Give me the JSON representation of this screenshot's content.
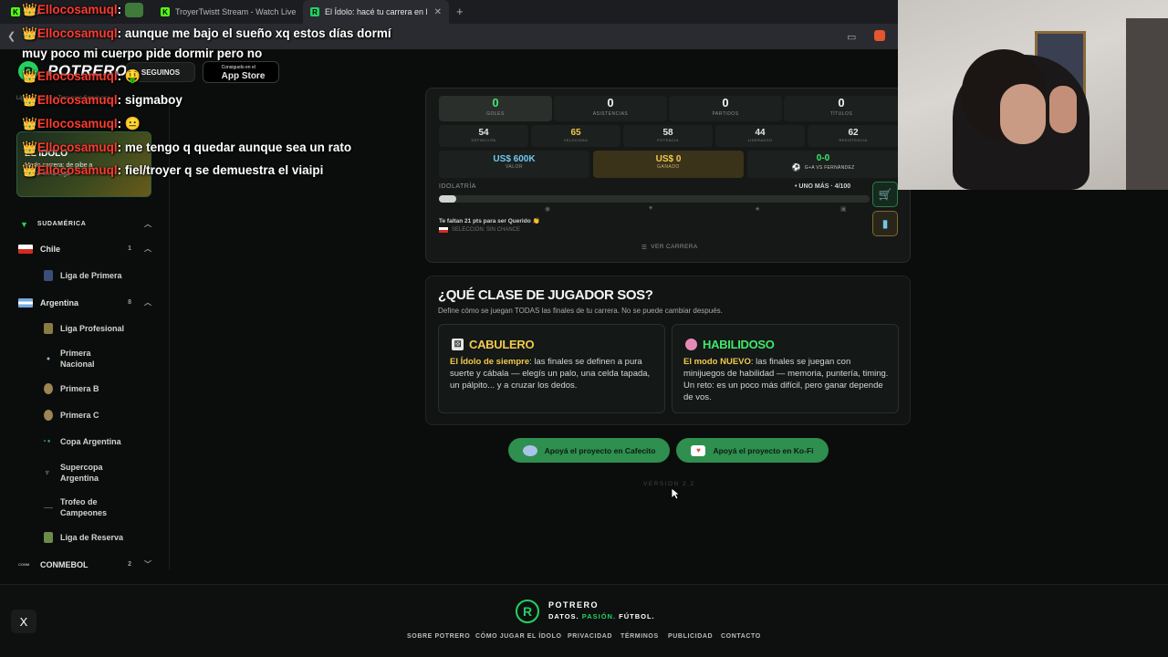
{
  "browser": {
    "tabs": [
      {
        "label": "Kick"
      },
      {
        "label": "TroyerTwistt Stream - Watch Live on Kick"
      },
      {
        "label": "El Ídolo: hacé tu carrera en la Liga",
        "active": true
      }
    ],
    "new_tab": "+"
  },
  "site": {
    "brand": "POTRERO",
    "follow_label": "SEGUINOS",
    "appstore_small": "Consiguelo en el",
    "appstore_big": "App Store",
    "breadcrumb_text": "Ligas, Equipos y Tops para Seguir aca."
  },
  "promo": {
    "title": "EL ÍDOLO",
    "subtitle": "Modo carrera: de pibe a figura en la Liga"
  },
  "sidebar": {
    "region": "SUDAMÉRICA",
    "countries": [
      {
        "name": "Chile",
        "count": "1",
        "items": [
          "Liga de Primera"
        ]
      },
      {
        "name": "Argentina",
        "count": "8",
        "items": [
          "Liga Profesional",
          "Primera Nacional",
          "Primera B",
          "Primera C",
          "Copa Argentina",
          "Supercopa Argentina",
          "Trofeo de Campeones",
          "Liga de Reserva"
        ]
      }
    ],
    "conmebol": {
      "name": "CONMEBOL",
      "count": "2"
    }
  },
  "stats": [
    {
      "value": "0",
      "label": "GOLES",
      "accent": "#3ee86b"
    },
    {
      "value": "0",
      "label": "ASISTENCIAS"
    },
    {
      "value": "0",
      "label": "PARTIDOS"
    },
    {
      "value": "0",
      "label": "TÍTULOS"
    }
  ],
  "attributes": [
    {
      "value": "54",
      "label": "DEFINICIÓN"
    },
    {
      "value": "65",
      "label": "VELOCIDAD",
      "accent": "#f2c94c"
    },
    {
      "value": "58",
      "label": "POTENCIA"
    },
    {
      "value": "44",
      "label": "LIDERAZGO"
    },
    {
      "value": "62",
      "label": "RESISTENCIA"
    }
  ],
  "money": {
    "value": "US$ 600K",
    "value_label": "VALOR",
    "earned": "US$ 0",
    "earned_label": "GANADO",
    "record": "0-0",
    "record_label": "G+A VS FERNÁNDEZ"
  },
  "idolatria": {
    "label": "IDOLATRÍA",
    "right": "• UNO MÁS · 4/100",
    "progress": 0.04,
    "hint": "Te faltan 21 pts para ser Querido 👏",
    "selection": "SELECCIÓN: SIN CHANCE",
    "view_career": "VER CARRERA"
  },
  "choice": {
    "title": "¿QUÉ CLASE DE JUGADOR SOS?",
    "subtitle": "Define cómo se juegan TODAS las finales de tu carrera. No se puede cambiar después.",
    "options": [
      {
        "title": "CABULERO",
        "lead": "El Ídolo de siempre",
        "text": ": las finales se definen a pura suerte y cábala — elegís un palo, una celda tapada, un pálpito... y a cruzar los dedos.",
        "lead_color": "#f2c94c",
        "icon": "dice-icon"
      },
      {
        "title": "HABILIDOSO",
        "lead": "El modo NUEVO",
        "text": ": las finales se juegan con minijuegos de habilidad — memoria, puntería, timing. Un reto: es un poco más difícil, pero ganar depende de vos.",
        "lead_color": "#f2c94c",
        "icon": "brain-icon"
      }
    ]
  },
  "donate": [
    {
      "label": "Apoyá el proyecto en Cafecito"
    },
    {
      "label": "Apoyá el proyecto en Ko-Fi"
    }
  ],
  "version": "VERSION 2.2",
  "footer": {
    "brand": "POTRERO",
    "tagline_1": "DATOS.",
    "tagline_2": "PASIÓN.",
    "tagline_3": "FÚTBOL.",
    "links": [
      "SOBRE POTRERO",
      "CÓMO JUGAR EL ÍDOLO",
      "PRIVACIDAD",
      "TÉRMINOS",
      "PUBLICIDAD",
      "CONTACTO"
    ],
    "x_label": "X"
  },
  "chat": [
    {
      "user": "Ellocosamuql",
      "msg": ""
    },
    {
      "user": "Ellocosamuql",
      "msg": "aunque me bajo el sueño xq estos días dormí"
    },
    {
      "user": "",
      "msg": "muy poco mi cuerpo pide dormir pero no"
    },
    {
      "user": "Ellocosamuql",
      "msg": ""
    },
    {
      "user": "Ellocosamuql",
      "msg": "sigmaboy"
    },
    {
      "user": "Ellocosamuql",
      "msg": ""
    },
    {
      "user": "Ellocosamuql",
      "msg": "me tengo q quedar aunque sea un rato"
    },
    {
      "user": "Ellocosamuql",
      "msg": "fiel/troyer q se demuestra el viaipi"
    }
  ],
  "colors": {
    "brand": "#23d160",
    "accent_yellow": "#f2c94c",
    "chat_user": "#ff3b30"
  }
}
